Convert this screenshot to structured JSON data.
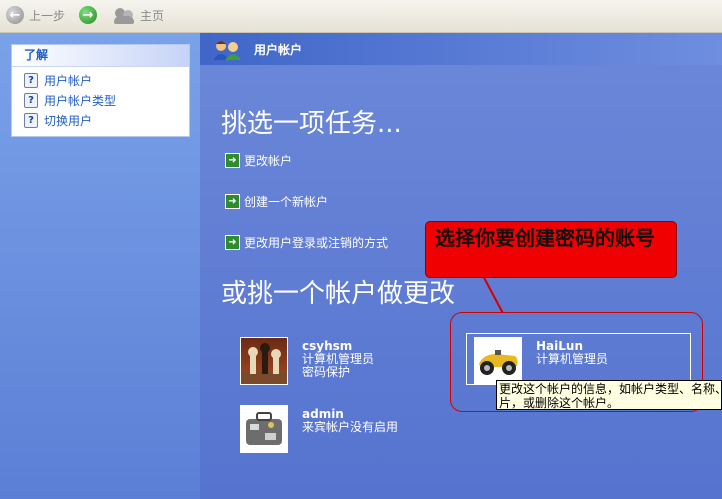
{
  "toolbar": {
    "back_label": "上一步",
    "home_label": "主页"
  },
  "sidebar": {
    "heading": "了解",
    "items": [
      {
        "label": "用户帐户"
      },
      {
        "label": "用户帐户类型"
      },
      {
        "label": "切换用户"
      }
    ]
  },
  "main": {
    "title": "用户帐户",
    "pick_task": "挑选一项任务...",
    "tasks": [
      {
        "label": "更改帐户"
      },
      {
        "label": "创建一个新帐户"
      },
      {
        "label": "更改用户登录或注销的方式"
      }
    ],
    "or_pick": "或挑一个帐户做更改",
    "accounts": [
      {
        "name": "csyhsm",
        "line1": "计算机管理员",
        "line2": "密码保护"
      },
      {
        "name": "HaiLun",
        "line1": "计算机管理员",
        "line2": ""
      },
      {
        "name": "admin",
        "line1": "来宾帐户没有启用",
        "line2": ""
      }
    ]
  },
  "annotation": {
    "callout_text": "选择你要创建密码的账号"
  },
  "tooltip": {
    "line1": "更改这个帐户的信息，如帐户类型、名称、",
    "line2": "片，或删除这个帐户。"
  }
}
